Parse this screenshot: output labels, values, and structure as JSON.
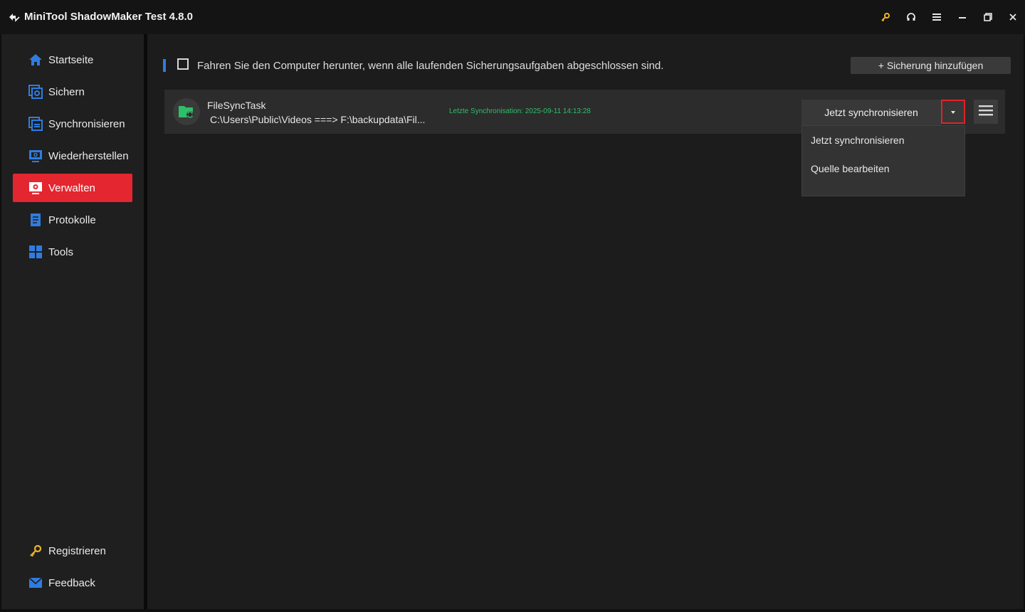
{
  "app": {
    "title": "MiniTool ShadowMaker Test 4.8.0",
    "accent_color": "#e3262f",
    "highlight_color": "#2f7ce0",
    "status_color": "#2fbf6a"
  },
  "titlebar": {
    "icons": [
      "key-icon",
      "headset-icon",
      "menu-icon",
      "minimize-icon",
      "restore-icon",
      "close-icon"
    ]
  },
  "sidebar": {
    "items": [
      {
        "label": "Startseite",
        "icon": "home-icon"
      },
      {
        "label": "Sichern",
        "icon": "backup-icon"
      },
      {
        "label": "Synchronisieren",
        "icon": "sync-icon"
      },
      {
        "label": "Wiederherstellen",
        "icon": "restore-monitor-icon"
      },
      {
        "label": "Verwalten",
        "icon": "manage-icon",
        "active": true
      },
      {
        "label": "Protokolle",
        "icon": "logs-icon"
      },
      {
        "label": "Tools",
        "icon": "tools-icon"
      }
    ],
    "bottom_items": [
      {
        "label": "Registrieren",
        "icon": "key-icon"
      },
      {
        "label": "Feedback",
        "icon": "mail-icon"
      }
    ]
  },
  "main": {
    "shutdown_checkbox_label": "Fahren Sie den Computer herunter, wenn alle laufenden Sicherungsaufgaben abgeschlossen sind.",
    "add_backup_label": "+ Sicherung hinzufügen",
    "task": {
      "name": "FileSyncTask",
      "path": "C:\\Users\\Public\\Videos ===> F:\\backupdata\\Fil...",
      "last_sync": "Letzte Synchronisation: 2025-09-11 14:13:28",
      "primary_action": "Jetzt synchronisieren"
    },
    "dropdown": {
      "items": [
        "Jetzt synchronisieren",
        "Quelle bearbeiten"
      ]
    }
  }
}
